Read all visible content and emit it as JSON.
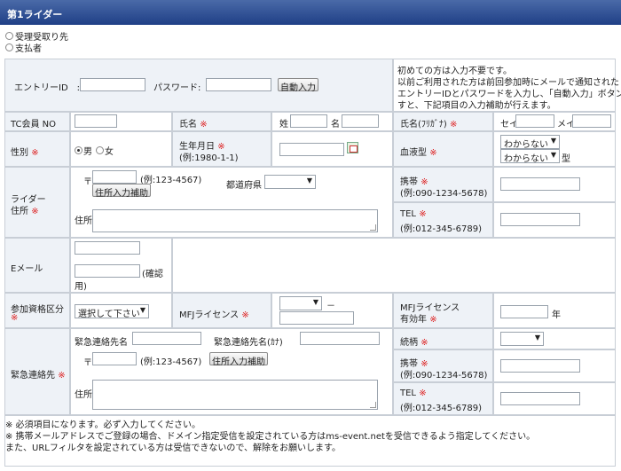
{
  "header": {
    "title": "第1ライダー"
  },
  "recipient_options": [
    {
      "label": "受理受取り先",
      "checked": false
    },
    {
      "label": "支払者",
      "checked": false
    }
  ],
  "entry": {
    "id_label": "エントリーID　:",
    "pw_label": "パスワード:",
    "auto_button": "自動入力",
    "info": [
      "初めての方は入力不要です。",
      "以前ご利用された方は前回参加時にメールで通知された",
      "エントリーIDとパスワードを入力し、「自動入力」ボタンを押",
      "すと、下記項目の入力補助が行えます。"
    ]
  },
  "required_mark": "※",
  "row_tc": {
    "tc_label": "TC会員 NO",
    "name_label": "氏名",
    "sei_label": "姓",
    "mei_label": "名",
    "kana_label": "氏名(ﾌﾘｶﾞﾅ)",
    "sei_kana": "セイ",
    "mei_kana": "メイ"
  },
  "row_gender": {
    "gender_label": "性別",
    "male": "男",
    "female": "女",
    "birth_label": "生年月日",
    "birth_example": "(例:1980-1-1)",
    "blood_label": "血液型",
    "blood_select_1": "わからない",
    "blood_select_2": "わからない",
    "blood_suffix": "型"
  },
  "rider_address": {
    "label_1": "ライダー",
    "label_2": "住所",
    "postal_mark": "〒",
    "postal_example": "(例:123-4567)",
    "postal_button": "住所入力補助",
    "prefecture_label": "都道府県",
    "address_label": "住所",
    "mobile_label": "携帯",
    "mobile_example": "(例:090-1234-5678)",
    "tel_label": "TEL",
    "tel_example": "(例:012-345-6789)"
  },
  "email": {
    "label": "Eメール",
    "confirm_1": "(確認",
    "confirm_2": "用)"
  },
  "qualification": {
    "label": "参加資格区分",
    "select": "選択して下さい",
    "mfj_label": "MFJライセンス",
    "dash": "－",
    "expiry_label_1": "MFJライセンス",
    "expiry_label_2": "有効年",
    "year_suffix": "年"
  },
  "emergency": {
    "label": "緊急連絡先",
    "name_label": "緊急連絡先名",
    "kana_label": "緊急連絡先名(ｶﾅ)",
    "relation_label": "続柄",
    "postal_mark": "〒",
    "postal_example": "(例:123-4567)",
    "postal_button": "住所入力補助",
    "address_label": "住所",
    "mobile_label": "携帯",
    "mobile_example": "(例:090-1234-5678)",
    "tel_label": "TEL",
    "tel_example": "(例:012-345-6789)"
  },
  "notes": [
    "※ 必須項目になります。必ず入力してください。",
    "※ 携帯メールアドレスでご登録の場合、ドメイン指定受信を設定されている方はms-event.netを受信できるよう指定してください。",
    "また、URLフィルタを設定されている方は受信できないので、解除をお願いします。"
  ]
}
